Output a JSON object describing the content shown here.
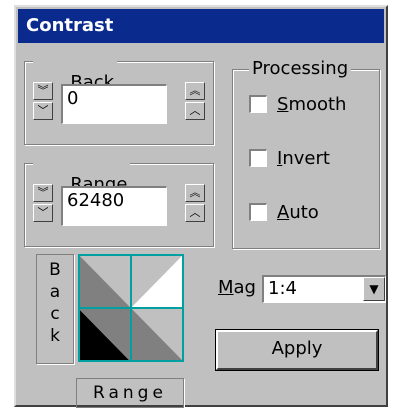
{
  "window": {
    "title": "Contrast"
  },
  "back": {
    "legend": "Back",
    "legend_key": "B",
    "legend_rest": "ack",
    "value": "0",
    "dec_fast_icon": "double-chevron-down-icon",
    "dec_icon": "chevron-down-icon",
    "inc_fast_icon": "double-chevron-up-icon",
    "inc_icon": "chevron-up-icon"
  },
  "range": {
    "legend": "Range",
    "legend_key": "R",
    "legend_rest": "ange",
    "value": "62480"
  },
  "processing": {
    "legend": "Processing",
    "options": [
      {
        "key": "S",
        "rest": "mooth",
        "label": "Smooth",
        "checked": false
      },
      {
        "key": "I",
        "rest": "nvert",
        "label": "Invert",
        "checked": false
      },
      {
        "key": "A",
        "rest": "uto",
        "label": "Auto",
        "checked": false
      }
    ]
  },
  "preview": {
    "vertical_label": [
      "B",
      "a",
      "c",
      "k"
    ],
    "horizontal_label": "Range",
    "grid_color": "#00a0a0"
  },
  "mag": {
    "label_key": "M",
    "label_rest": "ag",
    "value": "1:4",
    "dropdown_icon": "triangle-down-icon"
  },
  "apply": {
    "label": "Apply"
  },
  "colors": {
    "titlebar": "#0a2a8e",
    "face": "#c0c0c0"
  }
}
